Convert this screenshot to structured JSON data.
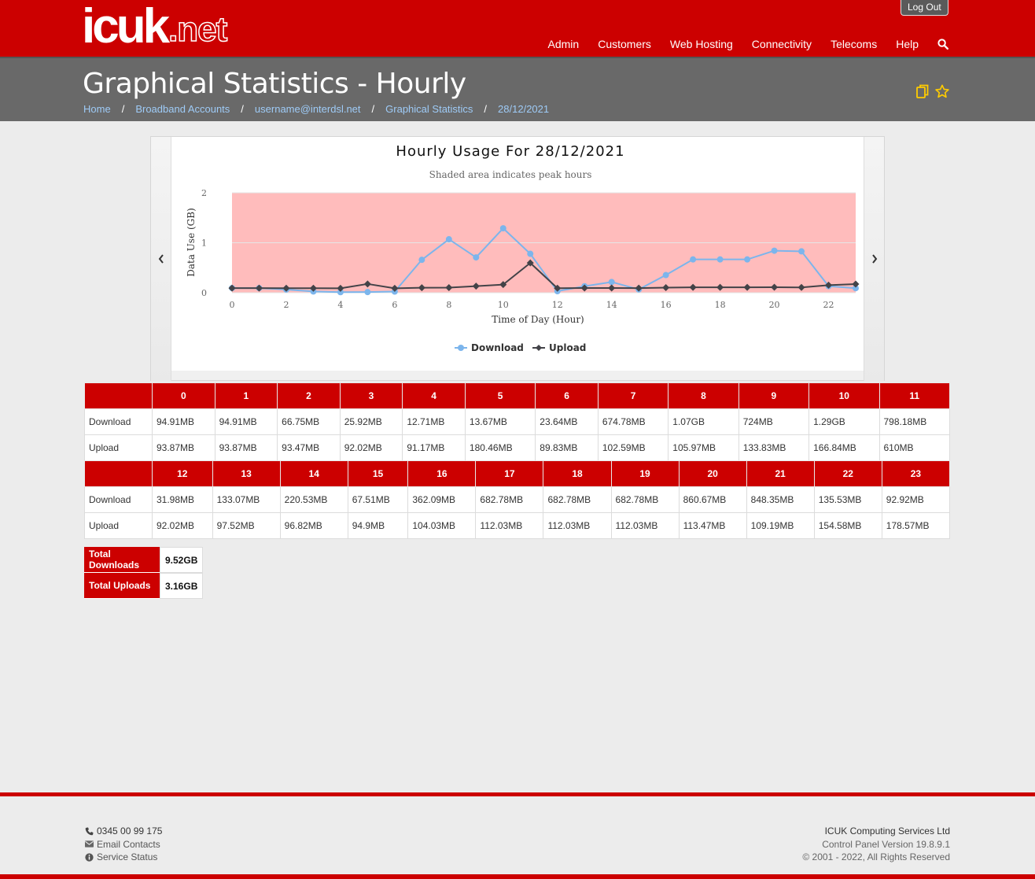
{
  "header": {
    "logo_main": "icuk",
    "logo_suffix": ".net",
    "logout_label": "Log Out",
    "nav": [
      "Admin",
      "Customers",
      "Web Hosting",
      "Connectivity",
      "Telecoms",
      "Help"
    ]
  },
  "page": {
    "title": "Graphical Statistics - Hourly",
    "breadcrumb": [
      "Home",
      "Broadband Accounts",
      "username@interdsl.net",
      "Graphical Statistics",
      "28/12/2021"
    ]
  },
  "chart_data": {
    "type": "line",
    "title": "Hourly Usage For 28/12/2021",
    "subtitle": "Shaded area indicates peak hours",
    "xlabel": "Time of Day (Hour)",
    "ylabel": "Data Use (GB)",
    "x": [
      0,
      1,
      2,
      3,
      4,
      5,
      6,
      7,
      8,
      9,
      10,
      11,
      12,
      13,
      14,
      15,
      16,
      17,
      18,
      19,
      20,
      21,
      22,
      23
    ],
    "xticks": [
      0,
      2,
      4,
      6,
      8,
      10,
      12,
      14,
      16,
      18,
      20,
      22
    ],
    "yticks": [
      0,
      1,
      2
    ],
    "ylim": [
      0,
      2
    ],
    "xlim": [
      0,
      23
    ],
    "peak_shading": [
      0,
      23
    ],
    "legend_position": "bottom",
    "series": [
      {
        "name": "Download",
        "color": "#7cb5ec",
        "marker": "circle",
        "values": [
          0.093,
          0.093,
          0.065,
          0.025,
          0.012,
          0.013,
          0.023,
          0.659,
          1.07,
          0.707,
          1.29,
          0.779,
          0.031,
          0.13,
          0.215,
          0.066,
          0.354,
          0.667,
          0.667,
          0.667,
          0.841,
          0.828,
          0.132,
          0.091
        ]
      },
      {
        "name": "Upload",
        "color": "#434348",
        "marker": "diamond",
        "values": [
          0.092,
          0.092,
          0.091,
          0.09,
          0.089,
          0.176,
          0.088,
          0.1,
          0.103,
          0.131,
          0.163,
          0.596,
          0.09,
          0.095,
          0.095,
          0.093,
          0.102,
          0.109,
          0.109,
          0.109,
          0.111,
          0.107,
          0.151,
          0.174
        ]
      }
    ]
  },
  "table": {
    "row_labels": [
      "Download",
      "Upload"
    ],
    "part1": {
      "hours": [
        "0",
        "1",
        "2",
        "3",
        "4",
        "5",
        "6",
        "7",
        "8",
        "9",
        "10",
        "11"
      ],
      "download": [
        "94.91MB",
        "94.91MB",
        "66.75MB",
        "25.92MB",
        "12.71MB",
        "13.67MB",
        "23.64MB",
        "674.78MB",
        "1.07GB",
        "724MB",
        "1.29GB",
        "798.18MB"
      ],
      "upload": [
        "93.87MB",
        "93.87MB",
        "93.47MB",
        "92.02MB",
        "91.17MB",
        "180.46MB",
        "89.83MB",
        "102.59MB",
        "105.97MB",
        "133.83MB",
        "166.84MB",
        "610MB"
      ]
    },
    "part2": {
      "hours": [
        "12",
        "13",
        "14",
        "15",
        "16",
        "17",
        "18",
        "19",
        "20",
        "21",
        "22",
        "23"
      ],
      "download": [
        "31.98MB",
        "133.07MB",
        "220.53MB",
        "67.51MB",
        "362.09MB",
        "682.78MB",
        "682.78MB",
        "682.78MB",
        "860.67MB",
        "848.35MB",
        "135.53MB",
        "92.92MB"
      ],
      "upload": [
        "92.02MB",
        "97.52MB",
        "96.82MB",
        "94.9MB",
        "104.03MB",
        "112.03MB",
        "112.03MB",
        "112.03MB",
        "113.47MB",
        "109.19MB",
        "154.58MB",
        "178.57MB"
      ]
    }
  },
  "totals": {
    "downloads_label": "Total Downloads",
    "downloads_value": "9.52GB",
    "uploads_label": "Total Uploads",
    "uploads_value": "3.16GB"
  },
  "footer": {
    "phone": "0345 00 99 175",
    "email": "Email Contacts",
    "status": "Service Status",
    "company": "ICUK Computing Services Ltd",
    "version": "Control Panel Version 19.8.9.1",
    "copyright": "© 2001 - 2022, All Rights Reserved"
  },
  "colors": {
    "brand_red": "#cc0000",
    "title_bar": "#696969",
    "peak_shading": "#ffbcbc",
    "link_blue": "#9ecbf7",
    "icon_yellow": "#ffcc00"
  }
}
